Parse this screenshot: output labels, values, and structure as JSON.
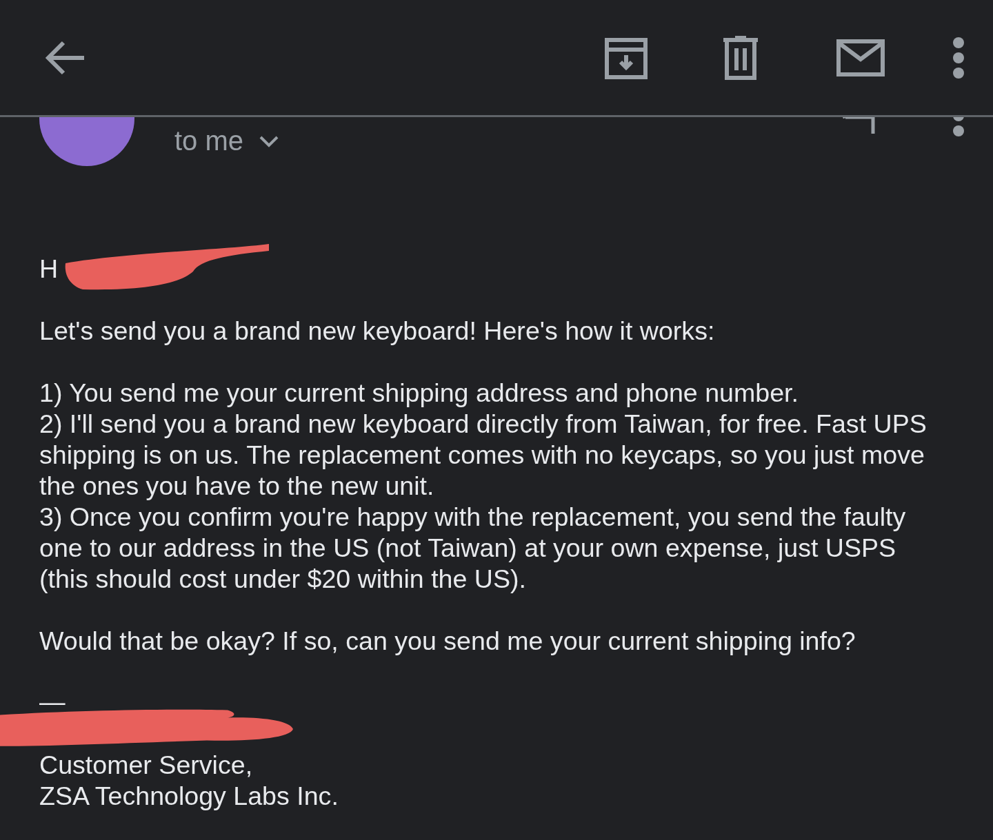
{
  "header": {
    "recipient": "to me"
  },
  "message": {
    "greeting": {
      "text": "H",
      "redacted": true
    },
    "intro": "Let's send you a brand new keyboard! Here's how it works:",
    "steps": [
      "1) You send me your current shipping address and phone number.",
      "2) I'll send you a brand new keyboard directly from Taiwan, for free. Fast UPS shipping is on us. The replacement comes with no keycaps, so you just move the ones you have to the new unit.",
      "3) Once you confirm you're happy with the replacement, you send the faulty one to our address in the US (not Taiwan) at your own expense, just USPS (this should cost under $20 within the US)."
    ],
    "question": "Would that be okay? If so, can you send me your current shipping info?",
    "signature": {
      "dash": "—",
      "redacted": true,
      "lines": [
        "Customer Service,",
        "ZSA Technology Labs Inc."
      ]
    }
  }
}
